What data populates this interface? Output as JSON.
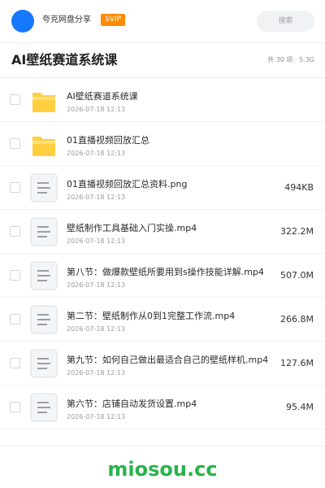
{
  "header": {
    "username": "夸克网盘分享",
    "badge": "SVIP",
    "search_placeholder": "搜索"
  },
  "title": "AI壁纸赛道系统课",
  "summary": "共 30 项 · 5.3G",
  "files": [
    {
      "type": "folder",
      "name": "AI壁纸赛道系统课",
      "date": "2026-07-18 12:13",
      "size": ""
    },
    {
      "type": "folder",
      "name": "01直播视频回放汇总",
      "date": "2026-07-18 12:13",
      "size": ""
    },
    {
      "type": "file",
      "name": "01直播视频回放汇总资料.png",
      "date": "2026-07-18 12:13",
      "size": "494KB"
    },
    {
      "type": "file",
      "name": "壁纸制作工具基础入门实操.mp4",
      "date": "2026-07-18 12:13",
      "size": "322.2M"
    },
    {
      "type": "file",
      "name": "第八节：做爆款壁纸所要用到s操作技能详解.mp4",
      "date": "2026-07-18 12:13",
      "size": "507.0M"
    },
    {
      "type": "file",
      "name": "第二节：壁纸制作从0到1完整工作流.mp4",
      "date": "2026-07-18 12:13",
      "size": "266.8M"
    },
    {
      "type": "file",
      "name": "第九节：如何自己做出最适合自己的壁纸样机.mp4",
      "date": "2026-07-18 12:13",
      "size": "127.6M"
    },
    {
      "type": "file",
      "name": "第六节：店铺自动发货设置.mp4",
      "date": "2026-07-18 12:13",
      "size": "95.4M"
    }
  ],
  "watermark": "miosou.cc",
  "colors": {
    "accent": "#1677ff",
    "badge": "#ff8a00",
    "folder": "#ffc93c",
    "watermark": "#27b34a"
  }
}
